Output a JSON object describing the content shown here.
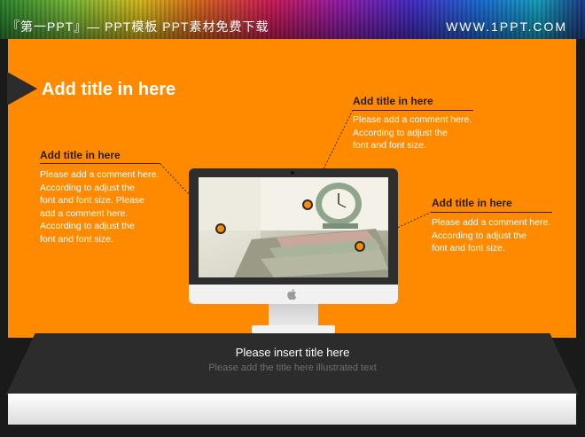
{
  "header": {
    "left_text": "『第一PPT』— PPT模板 PPT素材免费下载",
    "right_text": "WWW.1PPT.COM"
  },
  "slide": {
    "main_title": "Add title in here",
    "left_block": {
      "title": "Add title in here",
      "lines": [
        "Please add a comment here.",
        "According to adjust the",
        "font and font size. Please",
        "add a comment here.",
        "According to adjust the",
        "font and font size."
      ]
    },
    "top_right_block": {
      "title": "Add title in here",
      "lines": [
        "Please add a comment here.",
        "According to adjust the",
        "font and font size."
      ]
    },
    "right_block": {
      "title": "Add title in here",
      "lines": [
        "Please add a comment here.",
        "According to adjust the",
        "font and font size."
      ]
    },
    "bottom": {
      "title": "Please insert title here",
      "subtitle": "Please add the title here illustrated text"
    }
  },
  "colors": {
    "accent": "#ff8a00",
    "dark": "#2c2c2c"
  },
  "icons": [
    "apple-logo-icon",
    "title-arrow-icon"
  ]
}
